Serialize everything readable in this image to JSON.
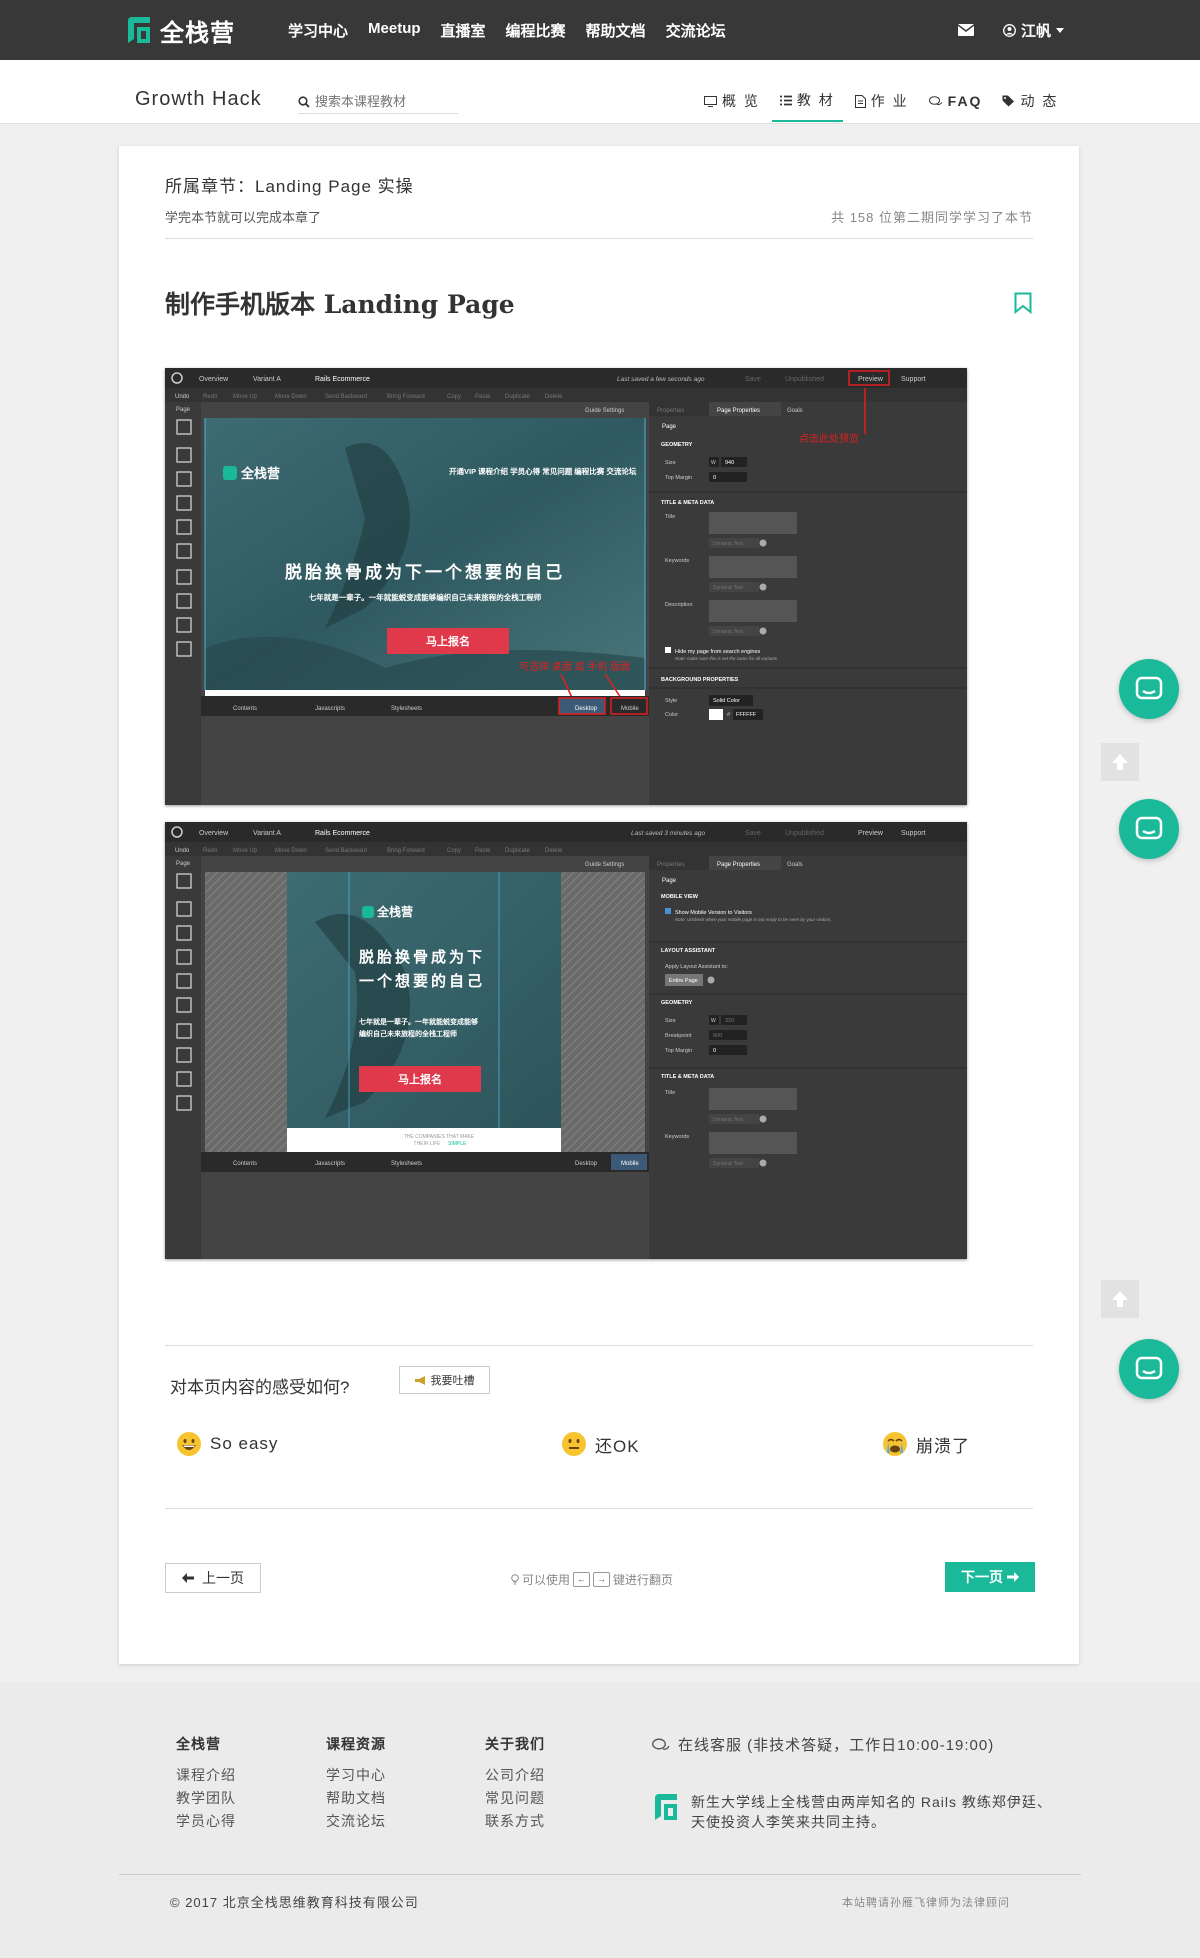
{
  "nav": {
    "logo_text": "全栈营",
    "links": [
      "学习中心",
      "Meetup",
      "直播室",
      "编程比赛",
      "帮助文档",
      "交流论坛"
    ],
    "user_name": "江帆",
    "brand_color": "#19b99a"
  },
  "subheader": {
    "course_title": "Growth Hack",
    "search_placeholder": "搜索本课程教材",
    "tabs": [
      {
        "label": "概 览",
        "icon": "monitor-icon",
        "active": false
      },
      {
        "label": "教 材",
        "icon": "list-icon",
        "active": true
      },
      {
        "label": "作 业",
        "icon": "document-icon",
        "active": false
      },
      {
        "label": "FAQ",
        "icon": "chat-icon",
        "active": false
      },
      {
        "label": "动 态",
        "icon": "tags-icon",
        "active": false
      }
    ]
  },
  "lesson": {
    "chapter": "所属章节：Landing Page 实操",
    "chapter_sub": "学完本节就可以完成本章了",
    "learners": "共 158 位第二期同学学习了本节",
    "title": "制作手机版本 Landing Page"
  },
  "screenshot1": {
    "topbar": [
      "Overview",
      "Variant A",
      "Rails Ecommerce",
      "Last saved  a few seconds ago",
      "Save",
      "Unpublished",
      "Preview",
      "Support"
    ],
    "toolbar": [
      "Undo",
      "Redo",
      "Move Up",
      "Move Down",
      "Send Backward",
      "Bring Forward",
      "Copy",
      "Paste",
      "Duplicate",
      "Delete"
    ],
    "page_label": "Page",
    "guide_settings": "Guide Settings",
    "hero_logo": "全栈营",
    "hero_nav": "开通VIP  课程介绍  学员心得  常见问题  编程比赛  交流论坛",
    "hero_headline": "脱胎换骨成为下一个想要的自己",
    "hero_sub": "七年就是一辈子。一年就能蜕变成能够编织自己未来旅程的全栈工程师",
    "hero_cta": "马上报名",
    "annotation_preview": "点击此处预览",
    "annotation_device": "可选择 桌面 或 手机 版面",
    "panel_tabs": [
      "Properties",
      "Page Properties",
      "Goals"
    ],
    "panel_page": "Page",
    "sec_geometry": "GEOMETRY",
    "size_label": "Size",
    "size_w": "W",
    "size_val": "940",
    "top_margin_label": "Top Margin",
    "top_margin_val": "0",
    "sec_title_meta": "TITLE & META DATA",
    "meta_title": "Title",
    "meta_keywords": "Keywords",
    "meta_description": "Description",
    "dynamic_text": "Dynamic Text",
    "hide_label": "Hide my page from search engines",
    "hide_note": "Note: make sure this is set the same for all variants",
    "sec_background": "BACKGROUND PROPERTIES",
    "style_label": "Style",
    "style_val": "Solid Color",
    "color_label": "Color",
    "color_hash": "#",
    "color_val": "FFFFFF",
    "bottom_tabs": [
      "Contents",
      "Javascripts",
      "Stylesheets"
    ],
    "device_desktop": "Desktop",
    "device_mobile": "Mobile"
  },
  "screenshot2": {
    "topbar": [
      "Overview",
      "Variant A",
      "Rails Ecommerce",
      "Last saved  3 minutes ago",
      "Save",
      "Unpublished",
      "Preview",
      "Support"
    ],
    "hero_logo": "全栈营",
    "hero_headline_1": "脱胎换骨成为下",
    "hero_headline_2": "一个想要的自己",
    "hero_sub_1": "七年就是一辈子。一年就能蜕变成能够",
    "hero_sub_2": "编织自己未来旅程的全栈工程师",
    "hero_cta": "马上报名",
    "below_fold_1": "THE COMPANIES THAT MAKE",
    "below_fold_2": "THEIR LIFE",
    "below_fold_3": "SIMPLE",
    "sec_mobile": "MOBILE VIEW",
    "show_mobile": "Show Mobile Version to Visitors",
    "show_mobile_note": "Note: Uncheck when your mobile page is not ready to be seen by your visitors.",
    "sec_layout": "LAYOUT ASSISTANT",
    "apply_layout": "Apply Layout Assistant to:",
    "entire_page": "Entire Page",
    "sec_geometry": "GEOMETRY",
    "size_label": "Size",
    "size_w": "W",
    "size_val": "320",
    "breakpoint_label": "Breakpoint",
    "breakpoint_val": "600",
    "top_margin_label": "Top Margin",
    "top_margin_val": "0",
    "sec_title_meta": "TITLE & META DATA",
    "meta_title": "Title",
    "meta_keywords": "Keywords"
  },
  "feedback": {
    "question": "对本页内容的感受如何?",
    "rant_button": "我要吐槽",
    "reactions": [
      "So easy",
      "还OK",
      "崩溃了"
    ]
  },
  "pager": {
    "prev": "上一页",
    "hint_prefix": "可以使用",
    "hint_suffix": "键进行翻页",
    "next": "下一页"
  },
  "footer": {
    "col1_title": "全栈营",
    "col1": [
      "课程介绍",
      "教学团队",
      "学员心得"
    ],
    "col2_title": "课程资源",
    "col2": [
      "学习中心",
      "帮助文档",
      "交流论坛"
    ],
    "col3_title": "关于我们",
    "col3": [
      "公司介绍",
      "常见问题",
      "联系方式"
    ],
    "service": "在线客服 (非技术答疑，工作日10:00-19:00)",
    "about": "新生大学线上全栈营由两岸知名的 Rails 教练郑伊廷、天使投资人李笑来共同主持。",
    "copyright": "© 2017 北京全栈思维教育科技有限公司",
    "legal": "本站聘请孙雁飞律师为法律顾问"
  }
}
